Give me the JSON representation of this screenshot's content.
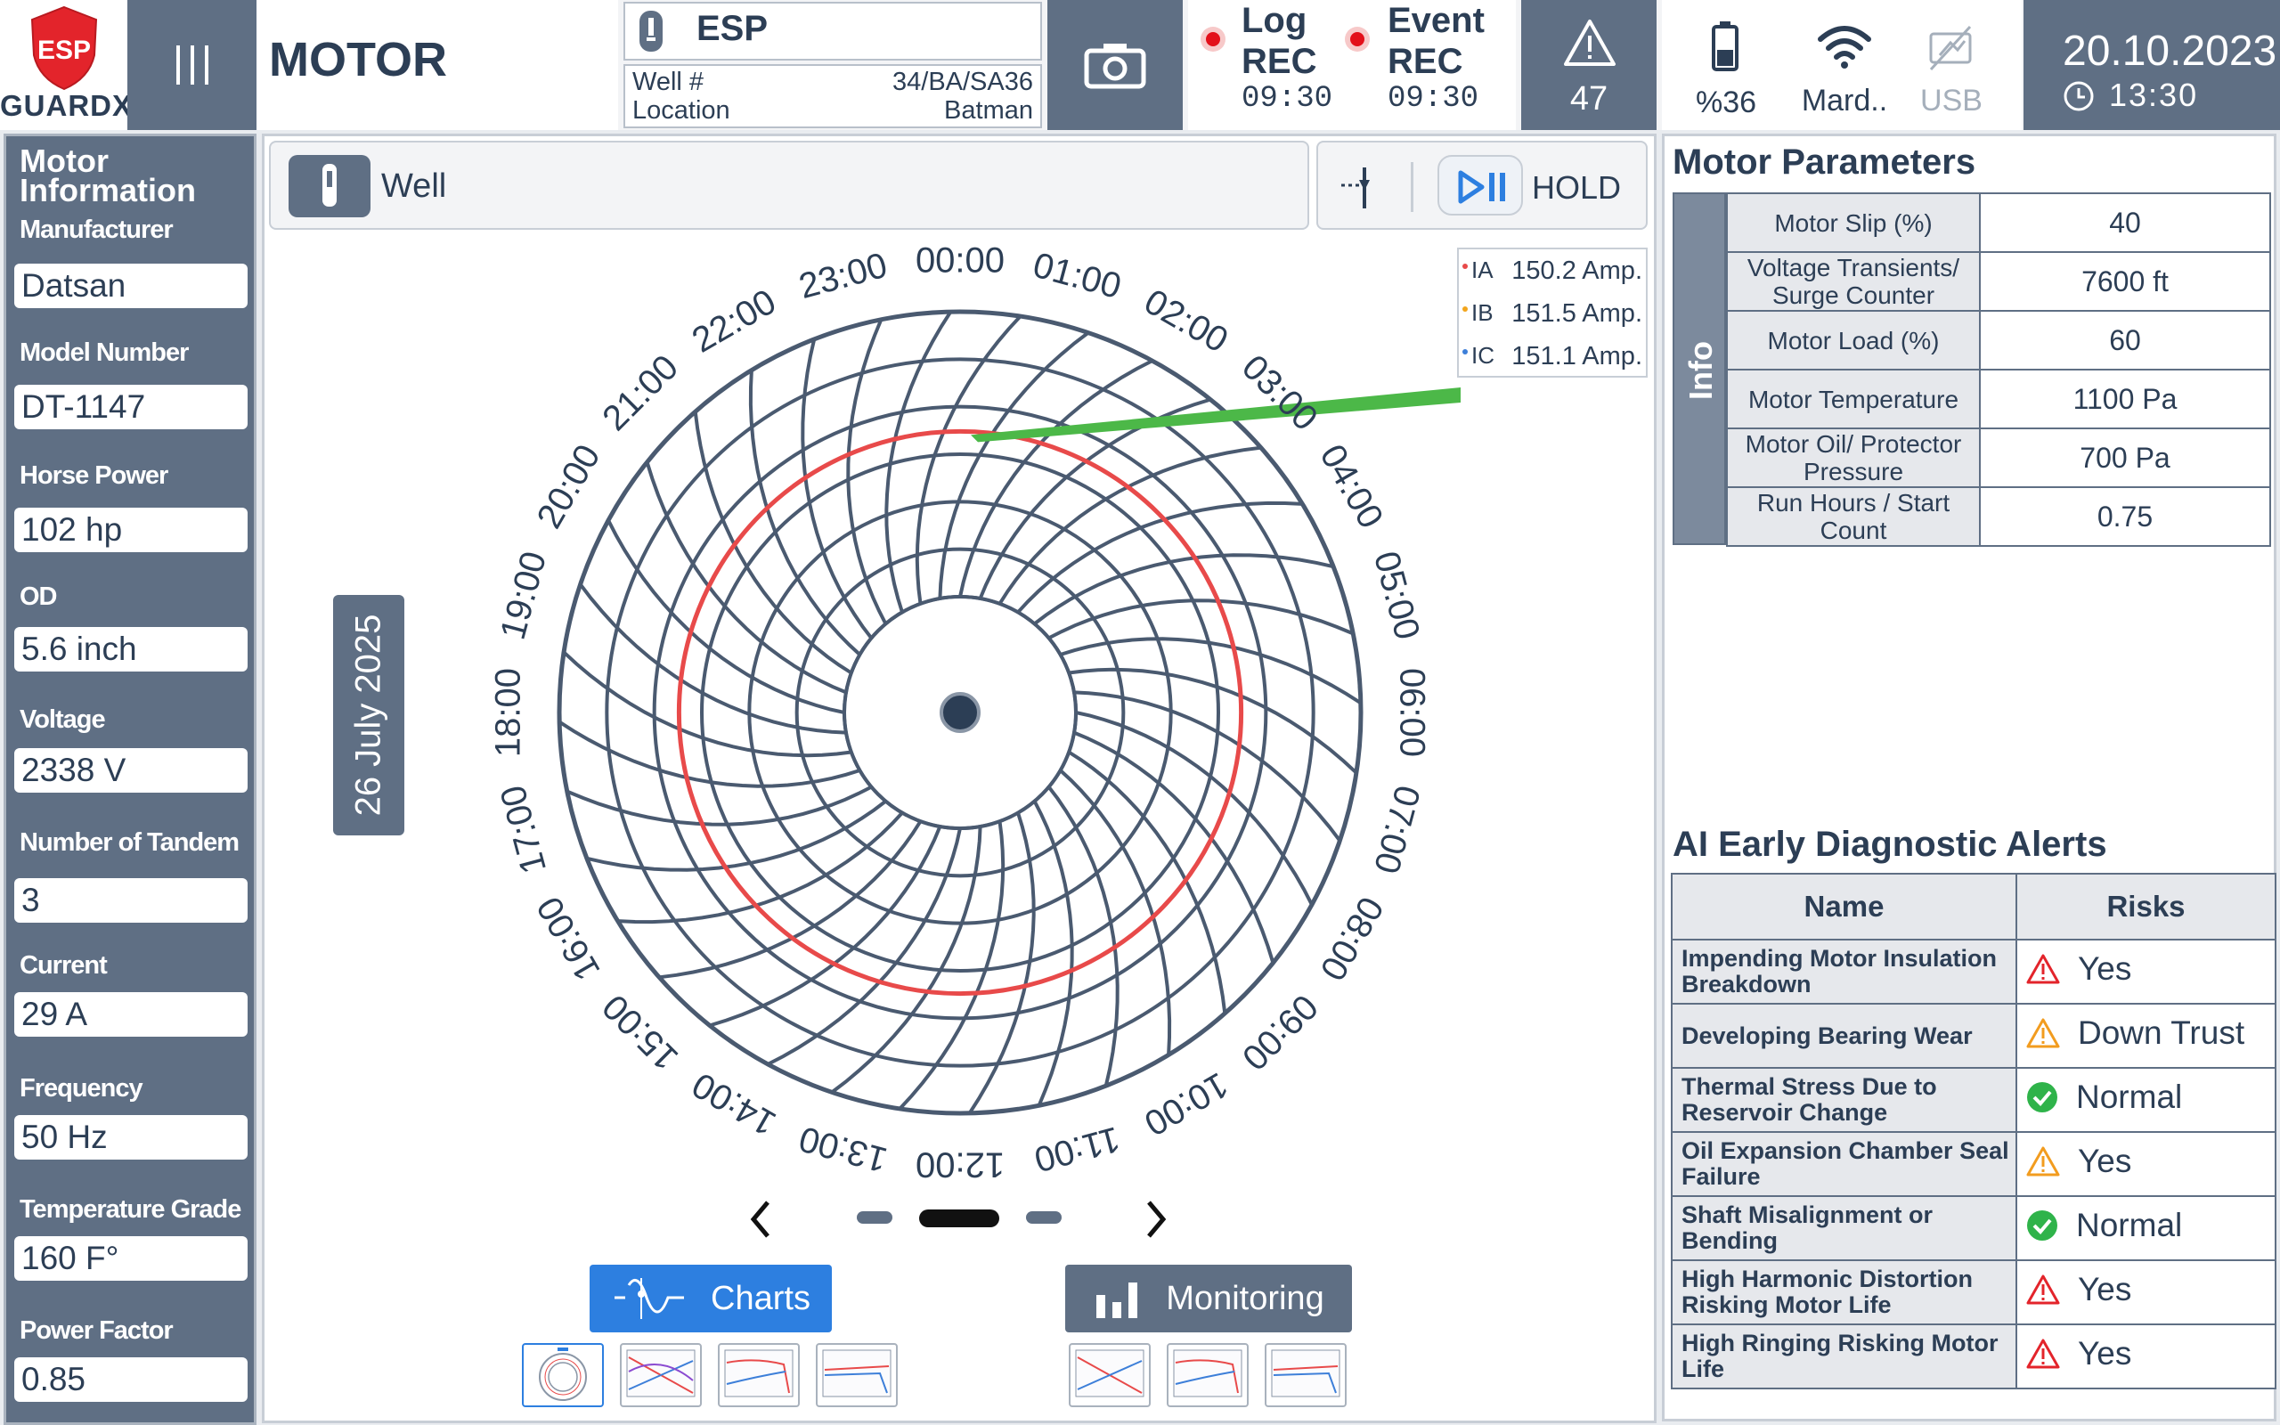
{
  "header": {
    "logo_top": "ESP",
    "logo_bottom": "GUARDX",
    "page_title": "MOTOR",
    "device": "ESP",
    "well_label": "Well #",
    "well_value": "34/BA/SA36",
    "location_label": "Location",
    "location_value": "Batman",
    "log_label_1": "Log",
    "log_label_2": "REC",
    "log_time": "09:30",
    "event_label_1": "Event",
    "event_label_2": "REC",
    "event_time": "09:30",
    "alarm_count": "47",
    "battery": "%36",
    "wifi": "Mard..",
    "usb": "USB",
    "date": "20.10.2023",
    "time": "13:30"
  },
  "sidebar": {
    "heading": "Motor Information",
    "fields": [
      {
        "label": "Manufacturer",
        "value": "Datsan"
      },
      {
        "label": "Model Number",
        "value": "DT-1147"
      },
      {
        "label": "Horse Power",
        "value": "102 hp"
      },
      {
        "label": "OD",
        "value": "5.6 inch"
      },
      {
        "label": "Voltage",
        "value": "2338 V"
      },
      {
        "label": "Number of Tandem",
        "value": "3"
      },
      {
        "label": "Current",
        "value": "29 A"
      },
      {
        "label": "Frequency",
        "value": "50 Hz"
      },
      {
        "label": "Temperature Grade",
        "value": "160 F°"
      },
      {
        "label": "Power Factor",
        "value": "0.85"
      }
    ]
  },
  "center": {
    "well_tab_label": "Well",
    "hold_label": "HOLD",
    "date_vertical": "26 July 2025",
    "legend": [
      {
        "label": "IA",
        "value": "150.2 Amp.",
        "color": "#e84a4a"
      },
      {
        "label": "IB",
        "value": "151.5 Amp.",
        "color": "#f2a51c"
      },
      {
        "label": "IC",
        "value": "151.1 Amp.",
        "color": "#3d7fd9"
      }
    ],
    "hours": [
      "00:00",
      "01:00",
      "02:00",
      "03:00",
      "04:00",
      "05:00",
      "06:00",
      "07:00",
      "08:00",
      "09:00",
      "10:00",
      "11:00",
      "12:00",
      "13:00",
      "14:00",
      "15:00",
      "16:00",
      "17:00",
      "18:00",
      "19:00",
      "20:00",
      "21:00",
      "22:00",
      "23:00"
    ],
    "charts_label": "Charts",
    "monitoring_label": "Monitoring"
  },
  "chart_data": {
    "type": "polar",
    "ring_color": "#e84a4a",
    "needle_color": "#4cb848",
    "ring_fraction": 0.58
  },
  "right": {
    "params_title": "Motor Parameters",
    "info_label": "Info",
    "params": [
      {
        "name": "Motor Slip (%)",
        "value": "40"
      },
      {
        "name": "Voltage  Transients/ Surge Counter",
        "value": "7600 ft"
      },
      {
        "name": "Motor Load (%)",
        "value": "60"
      },
      {
        "name": "Motor Temperature",
        "value": "1100 Pa"
      },
      {
        "name": "Motor Oil/ Protector Pressure",
        "value": "700 Pa"
      },
      {
        "name": "Run Hours / Start Count",
        "value": "0.75"
      }
    ],
    "alerts_title": "AI Early Diagnostic Alerts",
    "alerts_head_name": "Name",
    "alerts_head_risk": "Risks",
    "alerts": [
      {
        "name": "Impending Motor Insulation Breakdown",
        "risk": "Yes",
        "level": "red"
      },
      {
        "name": "Developing Bearing Wear",
        "risk": "Down Trust",
        "level": "orange"
      },
      {
        "name": "Thermal Stress Due to Reservoir Change",
        "risk": "Normal",
        "level": "green"
      },
      {
        "name": "Oil Expansion Chamber Seal Failure",
        "risk": "Yes",
        "level": "orange"
      },
      {
        "name": "Shaft Misalignment or Bending",
        "risk": "Normal",
        "level": "green"
      },
      {
        "name": "High Harmonic Distortion Risking Motor Life",
        "risk": "Yes",
        "level": "red"
      },
      {
        "name": "High Ringing Risking Motor Life",
        "risk": "Yes",
        "level": "red"
      }
    ]
  }
}
